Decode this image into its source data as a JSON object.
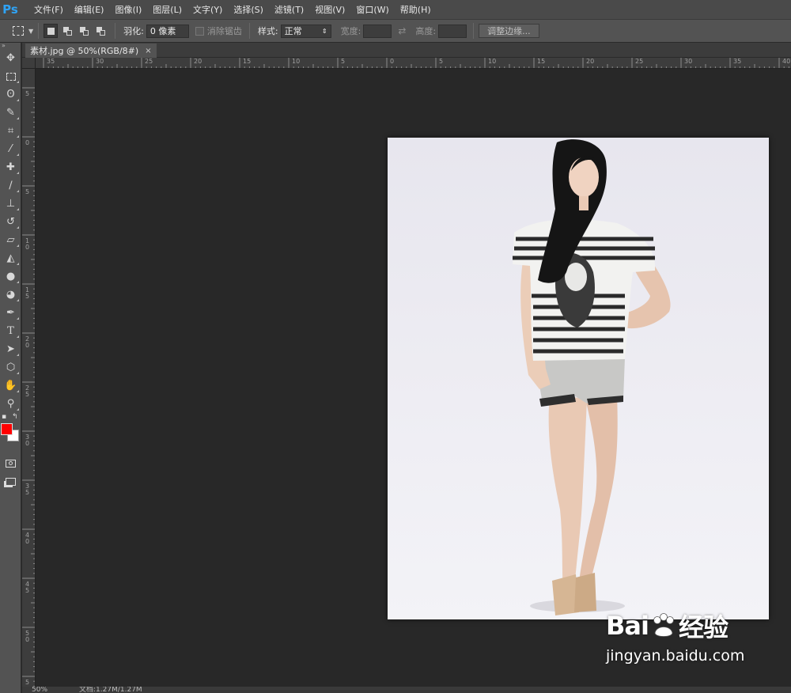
{
  "app": {
    "logo": "Ps"
  },
  "menu": [
    "文件(F)",
    "编辑(E)",
    "图像(I)",
    "图层(L)",
    "文字(Y)",
    "选择(S)",
    "滤镜(T)",
    "视图(V)",
    "窗口(W)",
    "帮助(H)"
  ],
  "options": {
    "feather_label": "羽化:",
    "feather_value": "0 像素",
    "antialias_label": "消除锯齿",
    "style_label": "样式:",
    "style_value": "正常",
    "width_label": "宽度:",
    "height_label": "高度:",
    "refine_edge_button": "调整边缘..."
  },
  "document": {
    "tab_title": "素材.jpg @ 50%(RGB/8#)",
    "close_glyph": "×"
  },
  "ruler": {
    "horizontal": [
      "35",
      "30",
      "25",
      "20",
      "15",
      "10",
      "5",
      "0",
      "5",
      "10",
      "15",
      "20",
      "25",
      "30",
      "35",
      "40"
    ],
    "vertical": [
      "5",
      "0",
      "5",
      "10",
      "15",
      "20",
      "25",
      "30",
      "35",
      "40",
      "45",
      "50",
      "5"
    ]
  },
  "colors": {
    "foreground": "#ff0000",
    "background": "#ffffff",
    "accent": "#2fa3f5"
  },
  "status": {
    "zoom": "50%",
    "doc_info": "文档:1.27M/1.27M"
  },
  "watermark": {
    "brand": "Bai",
    "brand_cn": "经验",
    "url": "jingyan.baidu.com"
  },
  "tools": [
    "move-tool-icon",
    "marquee-tool-icon",
    "lasso-tool-icon",
    "quick-select-tool-icon",
    "crop-tool-icon",
    "eyedropper-tool-icon",
    "healing-brush-tool-icon",
    "brush-tool-icon",
    "clone-stamp-tool-icon",
    "history-brush-tool-icon",
    "eraser-tool-icon",
    "paint-bucket-tool-icon",
    "blur-tool-icon",
    "dodge-tool-icon",
    "pen-tool-icon",
    "type-tool-icon",
    "path-select-tool-icon",
    "shape-tool-icon",
    "hand-tool-icon",
    "zoom-tool-icon"
  ]
}
